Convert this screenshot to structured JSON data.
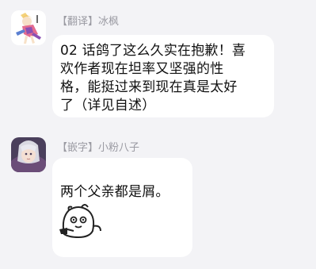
{
  "messages": [
    {
      "sender": "【翻译】冰枫",
      "text": "02 话鸽了这么久实在抱歉！喜欢作者现在坦率又坚强的性格，能挺过来到现在真是太好了（详见自述）",
      "lines": [
        "02 话鸽了这么久实在抱歉！喜",
        "欢作者现在坦率又坚强的性",
        "格，能挺过来到现在真是太好",
        "了（详见自述）"
      ]
    },
    {
      "sender": "【嵌字】小粉八子",
      "text": "两个父亲都是屑。",
      "sticker": "doodle-face-sticker"
    }
  ],
  "colors": {
    "background": "#f3f3f6",
    "bubble": "#ffffff",
    "sender_text": "#9a9aa2",
    "message_text": "#111111"
  }
}
